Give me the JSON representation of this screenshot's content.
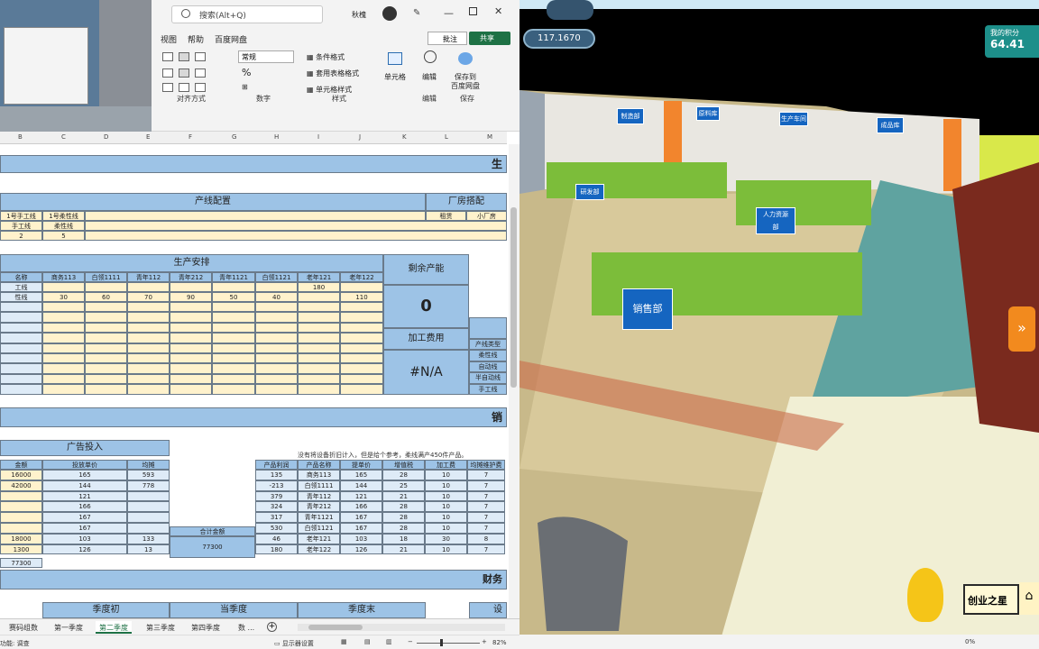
{
  "ribbon": {
    "search_placeholder": "搜索(Alt+Q)",
    "user": "秋槐",
    "comments": "批注",
    "share": "共享",
    "menus": [
      "视图",
      "帮助",
      "百度网盘"
    ],
    "groups": [
      "对齐方式",
      "数字",
      "样式",
      "编辑",
      "保存"
    ],
    "number_format": "常规",
    "cond_format": "条件格式",
    "table_format": "套用表格格式",
    "cell_style": "单元格样式",
    "cells": "单元格",
    "edit": "编辑",
    "save_to": "保存到",
    "baidu": "百度网盘"
  },
  "sheet": {
    "cols": [
      "B",
      "C",
      "D",
      "E",
      "F",
      "G",
      "H",
      "I",
      "J",
      "K",
      "L",
      "M"
    ],
    "title_sheng": "生",
    "title_xiao": "销",
    "title_cai": "财务",
    "title_she": "设",
    "line_config": "产线配置",
    "factory": "厂房搭配",
    "line_hdrs": [
      "1号手工线",
      "1号柔性线"
    ],
    "line_r2": [
      "手工线",
      "柔性线"
    ],
    "line_r3": [
      "2",
      "5"
    ],
    "factory_hdrs": [
      "租赁",
      "小厂房"
    ],
    "prod_plan": "生产安排",
    "remain_cap": "剩余产能",
    "remain_val": "0",
    "proc_fee": "加工费用",
    "proc_val": "#N/A",
    "plan_hdr": [
      "名称",
      "商务113",
      "白领1111",
      "青年112",
      "青年212",
      "青年1121",
      "白领1121",
      "老年121",
      "老年122"
    ],
    "plan_r1": [
      "工线",
      "",
      "",
      "",
      "",
      "",
      "",
      "180",
      ""
    ],
    "plan_r2": [
      "性线",
      "30",
      "60",
      "70",
      "90",
      "50",
      "40",
      "",
      "110"
    ],
    "side_types": [
      "产线类型",
      "柔性线",
      "自动线",
      "半自动线",
      "手工线"
    ],
    "ad_title": "广告投入",
    "ad_hdr": [
      "金额",
      "投放单价",
      "均摊"
    ],
    "ad_rows": [
      [
        "16000",
        "165",
        "593"
      ],
      [
        "42000",
        "144",
        "778"
      ],
      [
        "",
        "121",
        ""
      ],
      [
        "",
        "166",
        ""
      ],
      [
        "",
        "167",
        ""
      ],
      [
        "",
        "167",
        ""
      ],
      [
        "18000",
        "103",
        "133"
      ],
      [
        "1300",
        "126",
        "13"
      ]
    ],
    "ad_total": "77300",
    "total_label": "合计金额",
    "total_val": "77300",
    "note": "没有将设备折旧计入，但是给个参考，柔线满产450件产品。",
    "sales_hdr": [
      "产品利润",
      "产品名称",
      "提单价",
      "增值税",
      "加工费",
      "均摊维护费"
    ],
    "sales_rows": [
      [
        "135",
        "商务113",
        "165",
        "28",
        "10",
        "7"
      ],
      [
        "-213",
        "白领1111",
        "144",
        "25",
        "10",
        "7"
      ],
      [
        "379",
        "青年112",
        "121",
        "21",
        "10",
        "7"
      ],
      [
        "324",
        "青年212",
        "166",
        "28",
        "10",
        "7"
      ],
      [
        "317",
        "青年1121",
        "167",
        "28",
        "10",
        "7"
      ],
      [
        "530",
        "白领1121",
        "167",
        "28",
        "10",
        "7"
      ],
      [
        "46",
        "老年121",
        "103",
        "18",
        "30",
        "8"
      ],
      [
        "180",
        "老年122",
        "126",
        "21",
        "10",
        "7"
      ]
    ],
    "season": [
      "季度初",
      "当季度",
      "季度末"
    ]
  },
  "tabs": [
    "赛码组数",
    "第一季度",
    "第二季度",
    "第三季度",
    "第四季度",
    "数 ..."
  ],
  "status": {
    "left": "功能: 调查",
    "display": "显示器设置",
    "zoom": "82%"
  },
  "game": {
    "score_top": "117.1670",
    "my_score": "我的积分",
    "score": "64.41",
    "brand": "创业之星",
    "pct": "0%",
    "signs": [
      "制造部",
      "原料库",
      "生产车间",
      "成品库",
      "研发部",
      "人力资源部",
      "销售部"
    ]
  },
  "colors": {
    "blue": "#9dc3e6",
    "yellow": "#fff2cc",
    "excel_green": "#1e7145"
  }
}
